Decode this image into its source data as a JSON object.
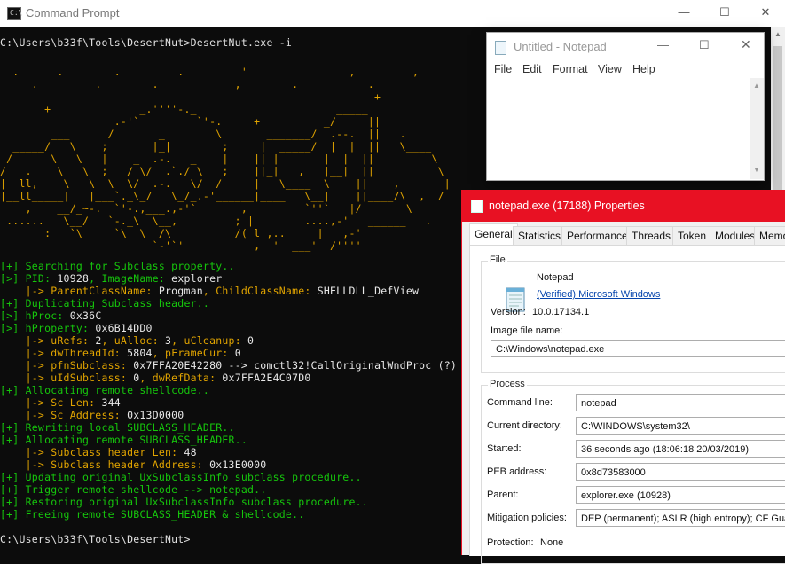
{
  "cmd": {
    "title": "Command Prompt",
    "icon": "console-icon",
    "controls": {
      "minimize": "—",
      "maximize": "☐",
      "close": "✕"
    },
    "command_line": "C:\\Users\\b33f\\Tools\\DesertNut>DesertNut.exe -i",
    "ascii_art": "  .      .        .         .         '                ,         ,\n     .         .        .            ,        .           .\n                                                           +\n       +              _.''''-._                      _____\n                  .-'`         `'-.     +          _/     ||\n        ___      /       _        \\       _______/  .--.  ||   .\n  _____/   \\    ;       |_|        ;     |  _____/  |  |  ||   \\____\n /      \\   \\   |    _  .-.   _    |    || |       |  |  ||         \\\n/   .    \\   \\  ;   / \\/  .`./ \\   ;    ||_|   ,   |__|  ||          \\\n|  ll,    \\   \\  \\  \\/  .-.   \\/  /     |   \\____  \\    ||    ,       |\n|__ll_____|   |___`._\\_/   \\_/_.-'______|____   \\__|    ||____/\\  ,  /\n    ,    __/_~-.  `'-.,___.,-'`       ,         `''`   |/       \\\n ......   \\__/   `-._\\  \\__,         ; |        ....,-'   ______   .\n       :   `\\     `\\  \\__/\\_         /(_l_,..     |   ,-'\n                        `-'`'           ,  '  ___'  /''''",
    "log": [
      {
        "parts": [
          {
            "c": "g",
            "t": "[+] Searching for Subclass property.."
          }
        ]
      },
      {
        "parts": [
          {
            "c": "g",
            "t": "[>] PID: "
          },
          {
            "c": "w",
            "t": "10928"
          },
          {
            "c": "g",
            "t": ", ImageName: "
          },
          {
            "c": "w",
            "t": "explorer"
          }
        ]
      },
      {
        "parts": [
          {
            "c": "o",
            "t": "    |-> ParentClassName: "
          },
          {
            "c": "w",
            "t": "Progman"
          },
          {
            "c": "o",
            "t": ", ChildClassName: "
          },
          {
            "c": "w",
            "t": "SHELLDLL_DefView"
          }
        ]
      },
      {
        "parts": [
          {
            "c": "g",
            "t": "[+] Duplicating Subclass header.."
          }
        ]
      },
      {
        "parts": [
          {
            "c": "g",
            "t": "[>] hProc: "
          },
          {
            "c": "w",
            "t": "0x36C"
          }
        ]
      },
      {
        "parts": [
          {
            "c": "g",
            "t": "[>] hProperty: "
          },
          {
            "c": "w",
            "t": "0x6B14DD0"
          }
        ]
      },
      {
        "parts": [
          {
            "c": "o",
            "t": "    |-> uRefs: "
          },
          {
            "c": "w",
            "t": "2"
          },
          {
            "c": "o",
            "t": ", uAlloc: "
          },
          {
            "c": "w",
            "t": "3"
          },
          {
            "c": "o",
            "t": ", uCleanup: "
          },
          {
            "c": "w",
            "t": "0"
          }
        ]
      },
      {
        "parts": [
          {
            "c": "o",
            "t": "    |-> dwThreadId: "
          },
          {
            "c": "w",
            "t": "5804"
          },
          {
            "c": "o",
            "t": ", pFrameCur: "
          },
          {
            "c": "w",
            "t": "0"
          }
        ]
      },
      {
        "parts": [
          {
            "c": "o",
            "t": "    |-> pfnSubclass: "
          },
          {
            "c": "w",
            "t": "0x7FFA20E42280 --> comctl32!CallOriginalWndProc (?)"
          }
        ]
      },
      {
        "parts": [
          {
            "c": "o",
            "t": "    |-> uIdSubclass: "
          },
          {
            "c": "w",
            "t": "0"
          },
          {
            "c": "o",
            "t": ", dwRefData: "
          },
          {
            "c": "w",
            "t": "0x7FFA2E4C07D0"
          }
        ]
      },
      {
        "parts": [
          {
            "c": "g",
            "t": "[+] Allocating remote shellcode.."
          }
        ]
      },
      {
        "parts": [
          {
            "c": "o",
            "t": "    |-> Sc Len: "
          },
          {
            "c": "w",
            "t": "344"
          }
        ]
      },
      {
        "parts": [
          {
            "c": "o",
            "t": "    |-> Sc Address: "
          },
          {
            "c": "w",
            "t": "0x13D0000"
          }
        ]
      },
      {
        "parts": [
          {
            "c": "g",
            "t": "[+] Rewriting local SUBCLASS_HEADER.."
          }
        ]
      },
      {
        "parts": [
          {
            "c": "g",
            "t": "[+] Allocating remote SUBCLASS_HEADER.."
          }
        ]
      },
      {
        "parts": [
          {
            "c": "o",
            "t": "    |-> Subclass header Len: "
          },
          {
            "c": "w",
            "t": "48"
          }
        ]
      },
      {
        "parts": [
          {
            "c": "o",
            "t": "    |-> Subclass header Address: "
          },
          {
            "c": "w",
            "t": "0x13E0000"
          }
        ]
      },
      {
        "parts": [
          {
            "c": "g",
            "t": "[+] Updating original UxSubclassInfo subclass procedure.."
          }
        ]
      },
      {
        "parts": [
          {
            "c": "g",
            "t": "[+] Trigger remote shellcode --> notepad.."
          }
        ]
      },
      {
        "parts": [
          {
            "c": "g",
            "t": "[+] Restoring original UxSubclassInfo subclass procedure.."
          }
        ]
      },
      {
        "parts": [
          {
            "c": "g",
            "t": "[+] Freeing remote SUBCLASS_HEADER & shellcode.."
          }
        ]
      }
    ],
    "final_prompt": "C:\\Users\\b33f\\Tools\\DesertNut>"
  },
  "notepad": {
    "title": "Untitled - Notepad",
    "menu": [
      "File",
      "Edit",
      "Format",
      "View",
      "Help"
    ]
  },
  "props": {
    "title": "notepad.exe (17188) Properties",
    "tabs": [
      "General",
      "Statistics",
      "Performance",
      "Threads",
      "Token",
      "Modules",
      "Memory"
    ],
    "file_group": "File",
    "file_name": "Notepad",
    "verified": "(Verified) Microsoft Windows",
    "version_label": "Version:",
    "version": "10.0.17134.1",
    "image_label": "Image file name:",
    "image_path": "C:\\Windows\\notepad.exe",
    "process_group": "Process",
    "fields": [
      {
        "label": "Command line:",
        "value": "notepad"
      },
      {
        "label": "Current directory:",
        "value": "C:\\WINDOWS\\system32\\"
      },
      {
        "label": "Started:",
        "value": "36 seconds ago (18:06:18 20/03/2019)"
      },
      {
        "label": "PEB address:",
        "value": "0x8d73583000"
      },
      {
        "label": "Parent:",
        "value": "explorer.exe (10928)"
      },
      {
        "label": "Mitigation policies:",
        "value": "DEP (permanent); ASLR (high entropy); CF Guard"
      }
    ],
    "protection_label": "Protection:",
    "protection_value": "None"
  }
}
